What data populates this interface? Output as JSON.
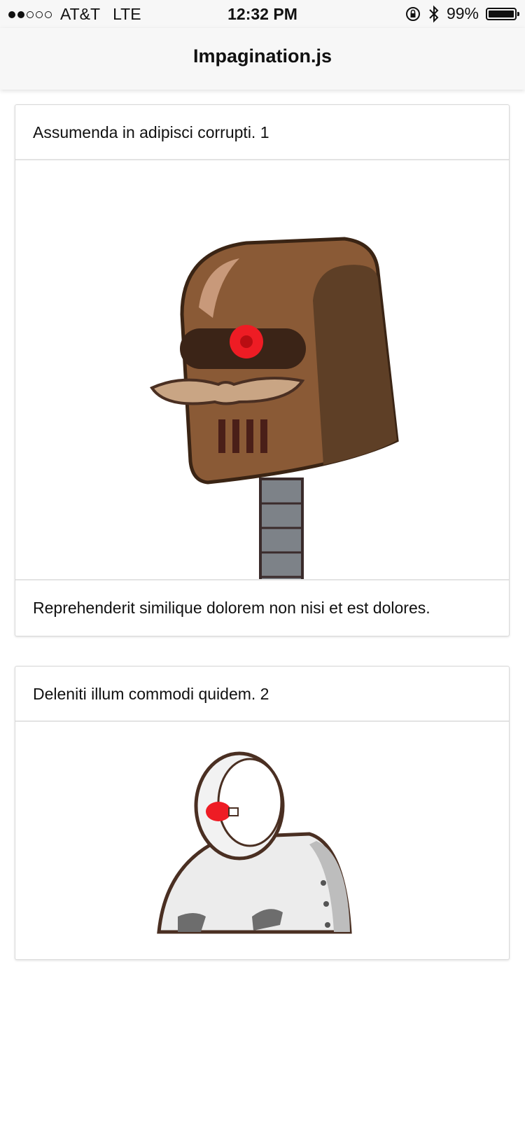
{
  "status_bar": {
    "carrier": "AT&T",
    "network": "LTE",
    "time": "12:32 PM",
    "battery": "99%",
    "signal_bars_filled": 2,
    "signal_bars_total": 5,
    "icons": [
      "rotation-lock-icon",
      "bluetooth-icon",
      "battery-icon"
    ]
  },
  "nav": {
    "title": "Impagination.js"
  },
  "cards": [
    {
      "title": "Assumenda in adipisci corrupti. 1",
      "image": "brown-robot-head-with-mustache",
      "description": "Reprehenderit similique dolorem non nisi et est dolores."
    },
    {
      "title": "Deleniti illum commodi quidem. 2",
      "image": "white-robot-with-red-eye"
    }
  ],
  "colors": {
    "bar_background": "#f7f7f7",
    "card_border": "#d9d9d9",
    "robot_brown": "#8a5a36",
    "robot_eye_red": "#ee1c24"
  }
}
